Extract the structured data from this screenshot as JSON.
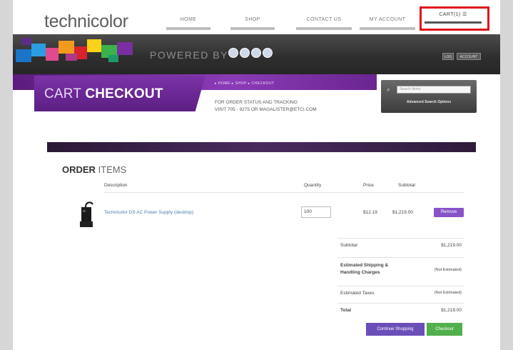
{
  "header": {
    "logo": "technicolor",
    "nav": [
      "HOME",
      "SHOP",
      "CONTACT US",
      "MY ACCOUNT"
    ],
    "cart": "CART(1) ☰"
  },
  "banner": {
    "powered_by": "POWERED BY",
    "login_buttons": [
      "LOG",
      "ACCOUNT"
    ]
  },
  "strip": {
    "title_light": "CART ",
    "title_bold": "CHECKOUT",
    "breadcrumb": "▸ HOME  ▸ SHOP  ▸ CHECKOUT",
    "order_status_line1": "FOR ORDER STATUS AND TRACKING",
    "order_status_line2": "VISIT 705 - 9275 OR MAGALISTER@ETCI.COM",
    "search_placeholder": "Search Items",
    "advanced_search": "Advanced Search Options"
  },
  "order": {
    "heading_bold": "ORDER",
    "heading_light": " ITEMS",
    "columns": [
      "Description",
      "Quantity",
      "Price",
      "Subtotal"
    ],
    "items": [
      {
        "description": "Technicolor DS AC Power Supply (desktop)",
        "quantity": "100",
        "price": "$12.19",
        "subtotal": "$1,219.00",
        "remove": "Remove"
      }
    ],
    "summary": [
      {
        "label": "Subtotal",
        "value": "$1,219.00"
      },
      {
        "label": "Estimated Shipping & Handling Charges",
        "value": "(Not Estimated)"
      },
      {
        "label": "Estimated Taxes",
        "value": "(Not Estimated)"
      },
      {
        "label": "Total",
        "value": "$1,219.00"
      }
    ],
    "continue_label": "Continue Shopping",
    "checkout_label": "Checkout"
  },
  "colors": {
    "accent_purple": "#8754c8",
    "highlight_red": "#e0141c",
    "checkout_green": "#51b04b"
  }
}
